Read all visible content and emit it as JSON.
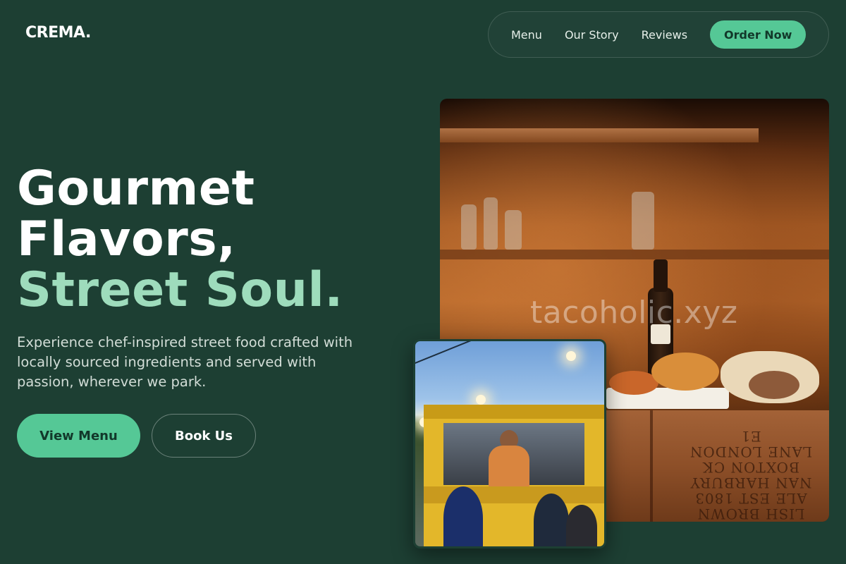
{
  "brand": {
    "logo": "CREMA."
  },
  "nav": {
    "links": [
      "Menu",
      "Our Story",
      "Reviews"
    ],
    "cta": "Order Now"
  },
  "hero": {
    "title_lines": [
      "Gourmet",
      "Flavors,",
      "Street Soul."
    ],
    "description": "Experience chef-inspired street food crafted with locally sourced ingredients and served with passion, wherever we park.",
    "primary_button": "View Menu",
    "secondary_button": "Book Us"
  },
  "images": {
    "main_watermark": "tacoholic.xyz",
    "crate_text": "LISH BROWN ALE EST 1803 NAN HARBURY BOXTON CK LANE LONDON E1"
  },
  "colors": {
    "background": "#1d3f33",
    "accent": "#55c896",
    "accent_light": "#9edcbc",
    "text": "#ffffff",
    "muted_text": "#d2ddd7"
  }
}
